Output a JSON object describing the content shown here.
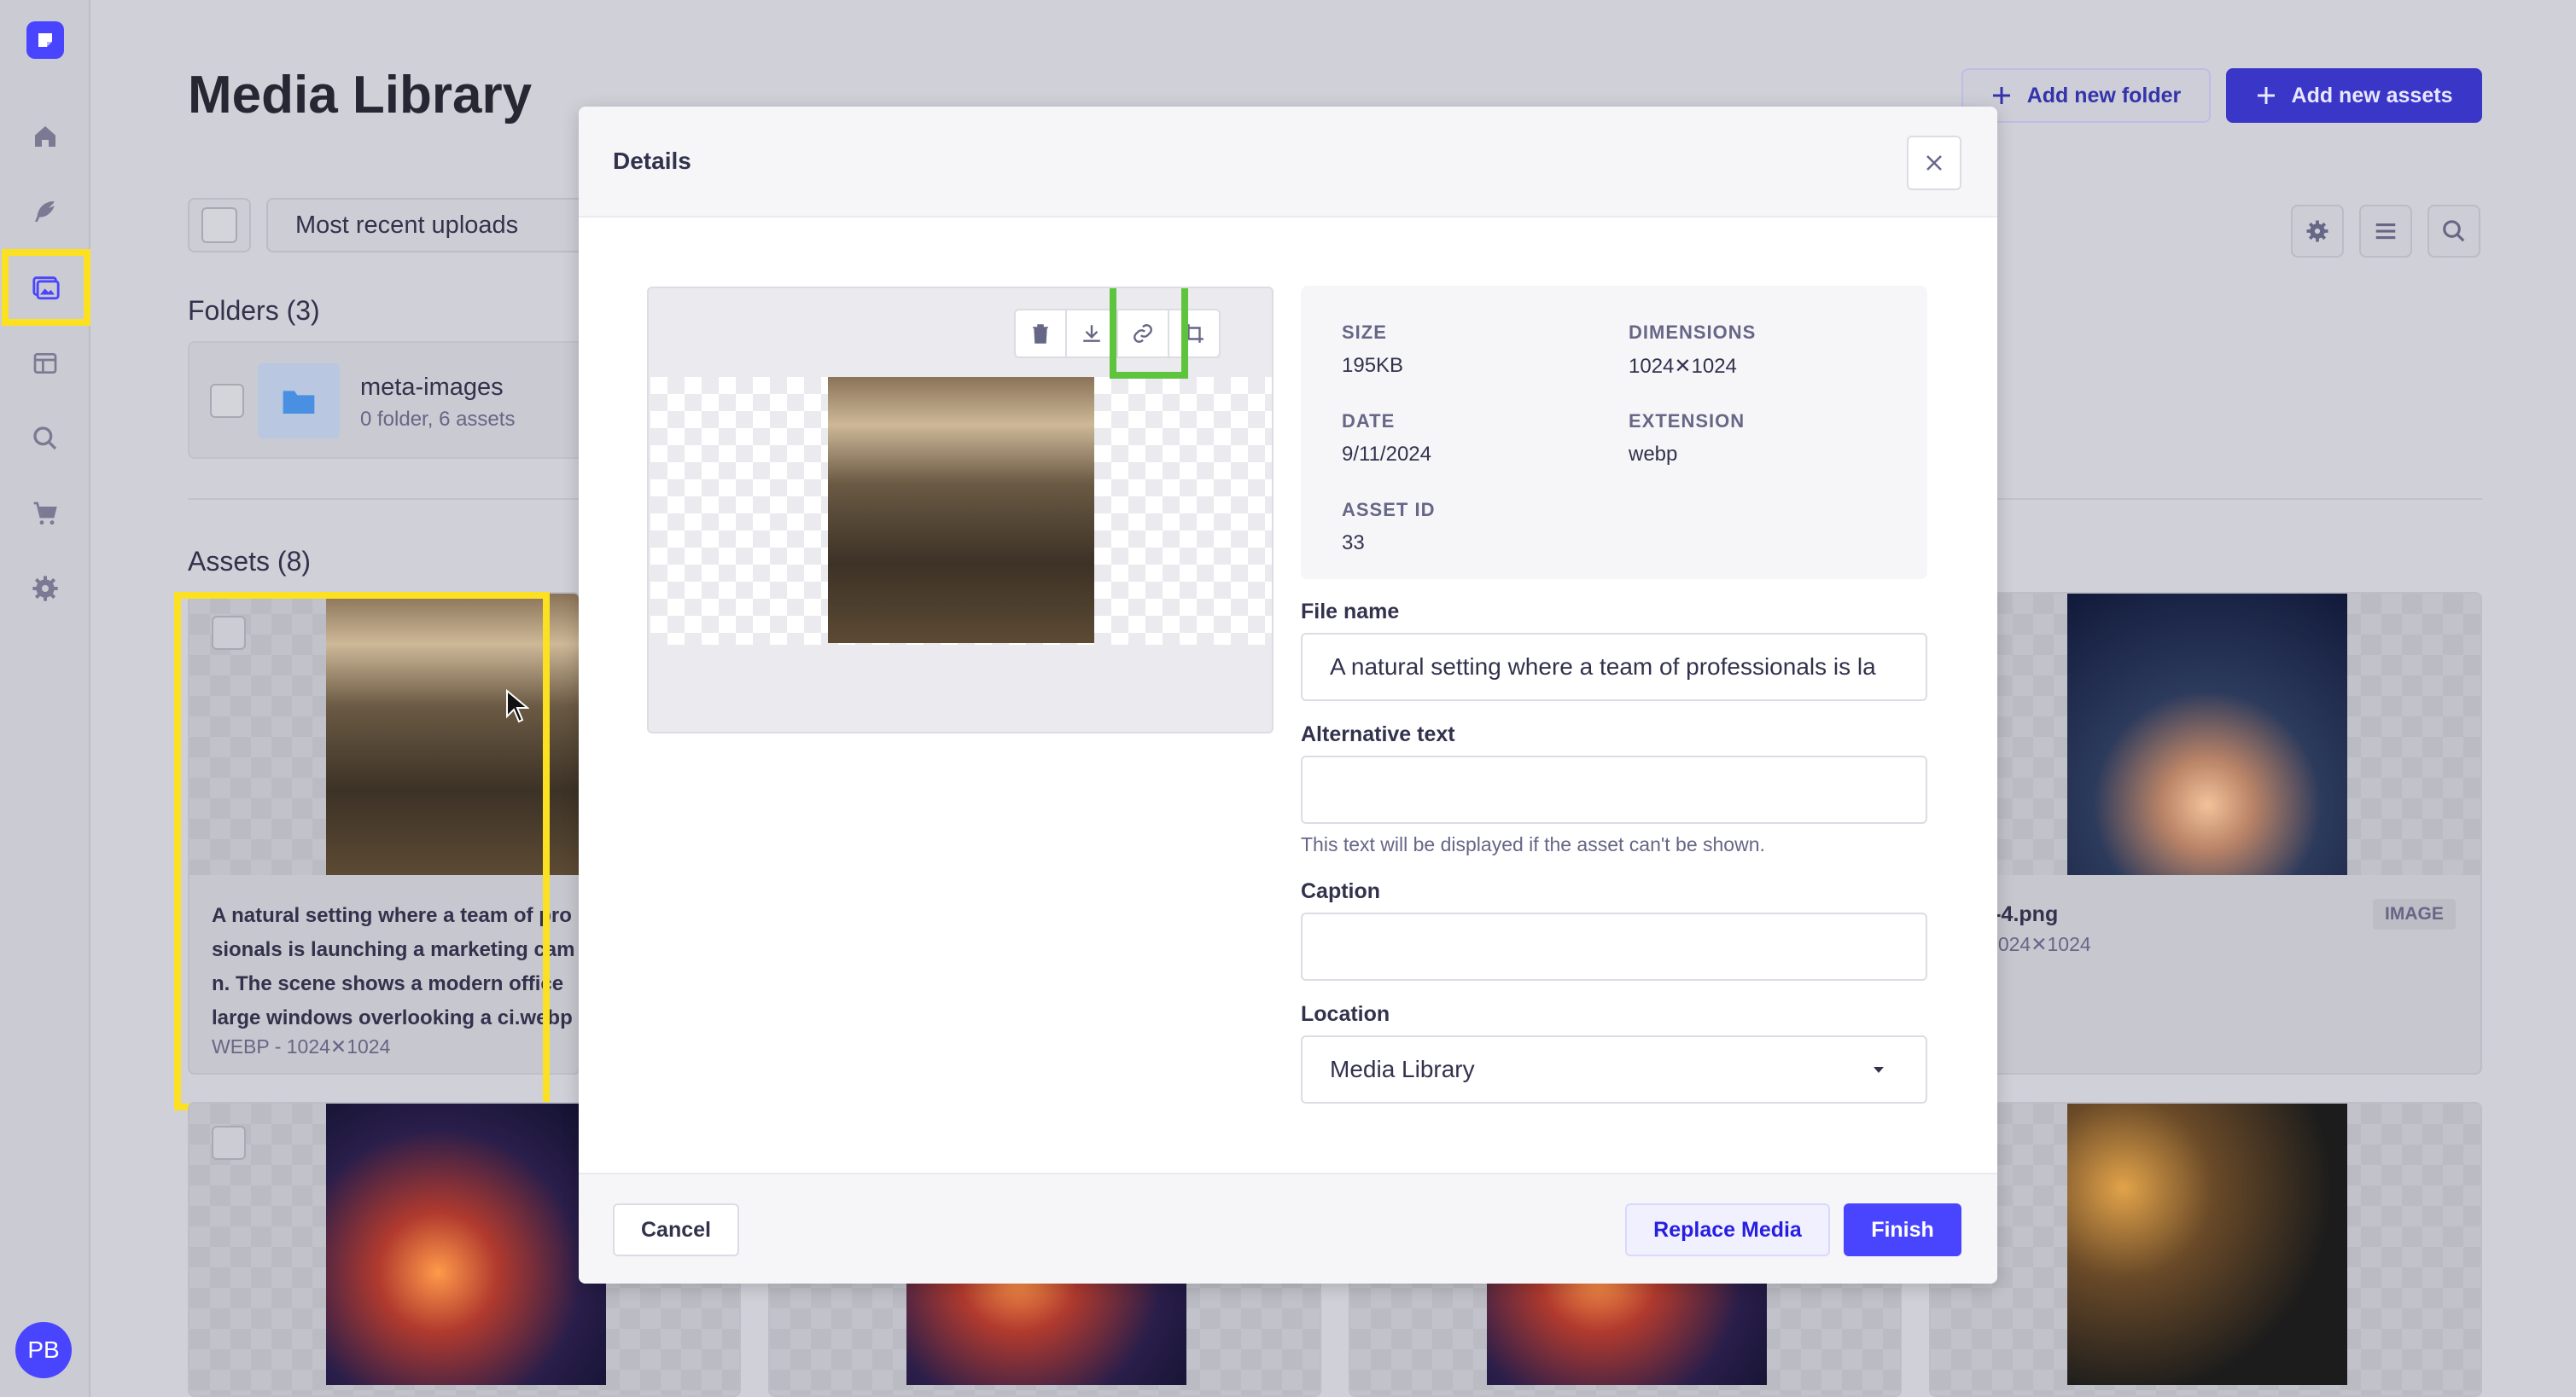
{
  "page": {
    "title": "Media Library",
    "add_folder_label": "Add new folder",
    "add_assets_label": "Add new assets",
    "sort_value": "Most recent uploads",
    "folders_heading": "Folders (3)",
    "assets_heading": "Assets (8)"
  },
  "sidebar": {
    "avatar_initials": "PB",
    "items": [
      "home-icon",
      "feather-icon",
      "media-icon",
      "layout-icon",
      "search-icon",
      "cart-icon",
      "settings-icon"
    ]
  },
  "folder": {
    "name": "meta-images",
    "meta": "0 folder, 6 assets"
  },
  "assets": [
    {
      "title_lines": [
        "A natural setting where a team of pro",
        "sionals is launching a marketing cam",
        "n. The scene shows a modern office",
        "large windows overlooking a ci.webp"
      ],
      "meta": "WEBP - 1024✕1024"
    },
    {
      "title": "et-4.png",
      "meta": "- 1024✕1024",
      "badge": "IMAGE"
    }
  ],
  "modal": {
    "title": "Details",
    "meta": {
      "size_label": "SIZE",
      "size_value": "195KB",
      "dimensions_label": "DIMENSIONS",
      "dimensions_value": "1024✕1024",
      "date_label": "DATE",
      "date_value": "9/11/2024",
      "extension_label": "EXTENSION",
      "extension_value": "webp",
      "asset_id_label": "ASSET ID",
      "asset_id_value": "33"
    },
    "file_name_label": "File name",
    "file_name_value": "A natural setting where a team of professionals is la",
    "alt_text_label": "Alternative text",
    "alt_text_value": "",
    "alt_text_hint": "This text will be displayed if the asset can't be shown.",
    "caption_label": "Caption",
    "caption_value": "",
    "location_label": "Location",
    "location_value": "Media Library",
    "cancel_label": "Cancel",
    "replace_label": "Replace Media",
    "finish_label": "Finish"
  },
  "colors": {
    "primary": "#4945ff",
    "highlight_yellow": "#fbe122",
    "highlight_green": "#5fc43d"
  }
}
